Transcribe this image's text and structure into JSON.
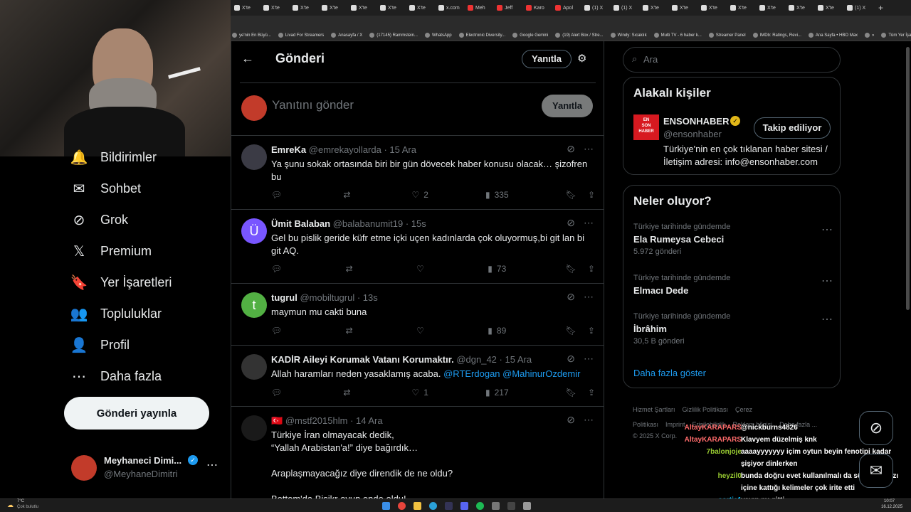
{
  "browser": {
    "tabs": [
      {
        "label": "X'te",
        "red": false
      },
      {
        "label": "X'te",
        "red": false
      },
      {
        "label": "X'te",
        "red": false
      },
      {
        "label": "X'te",
        "red": false
      },
      {
        "label": "X'te",
        "red": false
      },
      {
        "label": "X'te",
        "red": false
      },
      {
        "label": "X'te",
        "red": false
      },
      {
        "label": "x.com",
        "red": false
      },
      {
        "label": "Meh",
        "red": true
      },
      {
        "label": "Jeff",
        "red": true
      },
      {
        "label": "Karo",
        "red": true
      },
      {
        "label": "Apol",
        "red": true
      },
      {
        "label": "(1) X",
        "red": false
      },
      {
        "label": "(1) X",
        "red": false
      },
      {
        "label": "X'te",
        "red": false
      },
      {
        "label": "X'te",
        "red": false
      },
      {
        "label": "X'te",
        "red": false
      },
      {
        "label": "X'te",
        "red": false
      },
      {
        "label": "X'te",
        "red": false
      },
      {
        "label": "X'te",
        "red": false
      },
      {
        "label": "X'te",
        "red": false
      },
      {
        "label": "(1) X",
        "red": false
      }
    ],
    "bookmarks": [
      "ye'nin En Büyü...",
      "Livad For Streamers",
      "Anasayfa / X",
      "(17145) Rammstein...",
      "WhatsApp",
      "Electronic Diversity...",
      "Google Gemini",
      "(19) Alert Box / Stre...",
      "Windy: Sıcaklık",
      "Multi TV - 6 haber k...",
      "Streamer Panel",
      "IMDb: Ratings, Revi...",
      "Ana Sayfa • HBO Max",
      "»",
      "Tüm Yer İşaretleri"
    ]
  },
  "left_nav": {
    "items": [
      {
        "label": "Bildirimler",
        "icon": "bell-icon",
        "glyph": "🔔"
      },
      {
        "label": "Sohbet",
        "icon": "mail-icon",
        "glyph": "✉"
      },
      {
        "label": "Grok",
        "icon": "grok-icon",
        "glyph": "⊘"
      },
      {
        "label": "Premium",
        "icon": "x-logo-icon",
        "glyph": "𝕏"
      },
      {
        "label": "Yer İşaretleri",
        "icon": "bookmark-icon",
        "glyph": "🔖"
      },
      {
        "label": "Topluluklar",
        "icon": "communities-icon",
        "glyph": "👥"
      },
      {
        "label": "Profil",
        "icon": "profile-icon",
        "glyph": "👤"
      },
      {
        "label": "Daha fazla",
        "icon": "more-circle-icon",
        "glyph": "⋯"
      }
    ],
    "post_button": "Gönderi yayınla",
    "account": {
      "name": "Meyhaneci Dimi...",
      "handle": "@MeyhaneDimitri"
    }
  },
  "header": {
    "title": "Gönderi",
    "reply_button": "Yanıtla"
  },
  "composer": {
    "placeholder": "Yanıtını gönder",
    "button": "Yanıtla"
  },
  "tweets": [
    {
      "name": "EmreKa",
      "handle": "@emrekayollarda",
      "time": "· 15 Ara",
      "text": "Ya şunu sokak ortasında biri bir gün dövecek haber konusu olacak… şizofren bu",
      "replies": "",
      "retweets": "",
      "likes": "2",
      "views": "335",
      "avatar_color": "#3b3b45",
      "avatar_letter": ""
    },
    {
      "name": "Ümit Balaban",
      "handle": "@balabanumit19",
      "time": "· 15s",
      "text": "Gel bu pislik geride küfr etme içki uçen kadınlarda çok oluyormuş,bi git lan bi git AQ.",
      "replies": "",
      "retweets": "",
      "likes": "",
      "views": "73",
      "avatar_color": "#7856ff",
      "avatar_letter": "Ü"
    },
    {
      "name": "tugrul",
      "handle": "@mobiltugrul",
      "time": "· 13s",
      "text": "maymun mu cakti buna",
      "replies": "",
      "retweets": "",
      "likes": "",
      "views": "89",
      "avatar_color": "#52b043",
      "avatar_letter": "t"
    },
    {
      "name": "KADİR Aileyi Korumak Vatanı Korumaktır.",
      "handle": "@dgn_42",
      "time": "· 15 Ara",
      "text": "Allah haramları neden yasaklamış acaba.",
      "mentions": "@RTErdogan @MahinurOzdemir",
      "replies": "",
      "retweets": "",
      "likes": "1",
      "views": "217",
      "avatar_color": "#333333",
      "avatar_letter": ""
    },
    {
      "name": "🇹🇷",
      "handle": "@mstf2015hlm",
      "time": "· 14 Ara",
      "text_lines": [
        "Türkiye İran olmayacak dedik,",
        "“Yallah Arabistan'a!” diye bağırdık…",
        "",
        "Araplaşmayacağız diye direndik de ne oldu?",
        "",
        "Bottom'da Bisikr oyun ende oldu!"
      ],
      "avatar_color": "#1a1a1a",
      "avatar_letter": ""
    }
  ],
  "search": {
    "placeholder": "Ara"
  },
  "related": {
    "title": "Alakalı kişiler",
    "person": {
      "name": "ENSONHABER",
      "handle": "@ensonhaber",
      "bio": "Türkiye'nin en çok tıklanan haber sitesi / İletişim adresi: info@ensonhaber.com",
      "follow_button": "Takip ediliyor",
      "logo_text_1": "EN",
      "logo_text_2": "SON",
      "logo_text_3": "HABER"
    }
  },
  "trends": {
    "title": "Neler oluyor?",
    "items": [
      {
        "context": "Türkiye tarihinde gündemde",
        "name": "Ela Rumeysa Cebeci",
        "count": "5.972 gönderi"
      },
      {
        "context": "Türkiye tarihinde gündemde",
        "name": "Elmacı Dede",
        "count": ""
      },
      {
        "context": "Türkiye tarihinde gündemde",
        "name": "İbrâhim",
        "count": "30,5 B gönderi"
      }
    ],
    "show_more": "Daha fazla göster"
  },
  "footer": {
    "links": [
      "Hizmet Şartları",
      "Gizlilik Politikası",
      "Çerez Politikası",
      "Imprint",
      "Erişilebilirlik",
      "Reklam bilgisi",
      "Daha fazla ..."
    ],
    "copyright": "© 2025 X Corp."
  },
  "chat_overlay": [
    {
      "user": "AltayKARAPARS",
      "msg": "@nickburns4826",
      "color": "#ff6b6b"
    },
    {
      "user": "AltayKARAPARS",
      "msg": "Klavyem düzelmiş knk",
      "color": "#ff6b6b"
    },
    {
      "user": "7balonjoje",
      "msg": "aaaayyyyyyy içim oytun beyin fenotipi kadar",
      "color": "#9acd32"
    },
    {
      "user": "",
      "msg": "şişiyor dinlerken",
      "color": "#9acd32"
    },
    {
      "user": "heyzil0",
      "msg": "bunda doğru evet kullanılmalı da söyleyiş tarzı",
      "color": "#9acd32"
    },
    {
      "user": "",
      "msg": "içine kattığı kelimeler çok irite etti",
      "color": "#9acd32"
    },
    {
      "user": "sortie1",
      "msg": "yayın mı gitti",
      "color": "#00bfff"
    }
  ],
  "taskbar": {
    "weather_temp": "7°C",
    "weather_desc": "Çok bulutlu",
    "time": "10:07",
    "date": "16.12.2025"
  }
}
